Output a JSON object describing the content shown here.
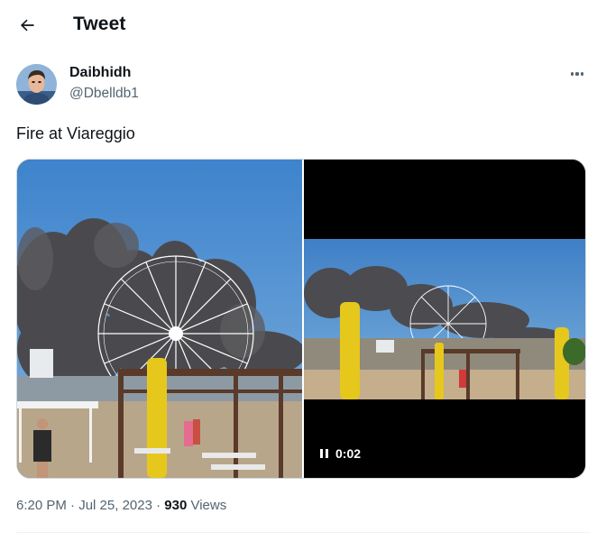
{
  "header": {
    "back_icon": "arrow-left-icon",
    "title": "Tweet"
  },
  "author": {
    "name": "Daibhidh",
    "handle": "@Dbelldb1",
    "more_icon": "more-horizontal-icon"
  },
  "tweet": {
    "text": "Fire at Viareggio"
  },
  "media": {
    "photo_alt": "Ferris wheel on beach with smoke",
    "video_time": "0:02",
    "pause_icon": "pause-icon"
  },
  "meta": {
    "time": "6:20 PM",
    "sep1": " · ",
    "date": "Jul 25, 2023",
    "sep2": " · ",
    "views_count": "930",
    "views_label": " Views"
  },
  "colors": {
    "text": "#0f1419",
    "secondary": "#536471",
    "border": "#cfd9de",
    "sky": "#4a8ed1"
  }
}
